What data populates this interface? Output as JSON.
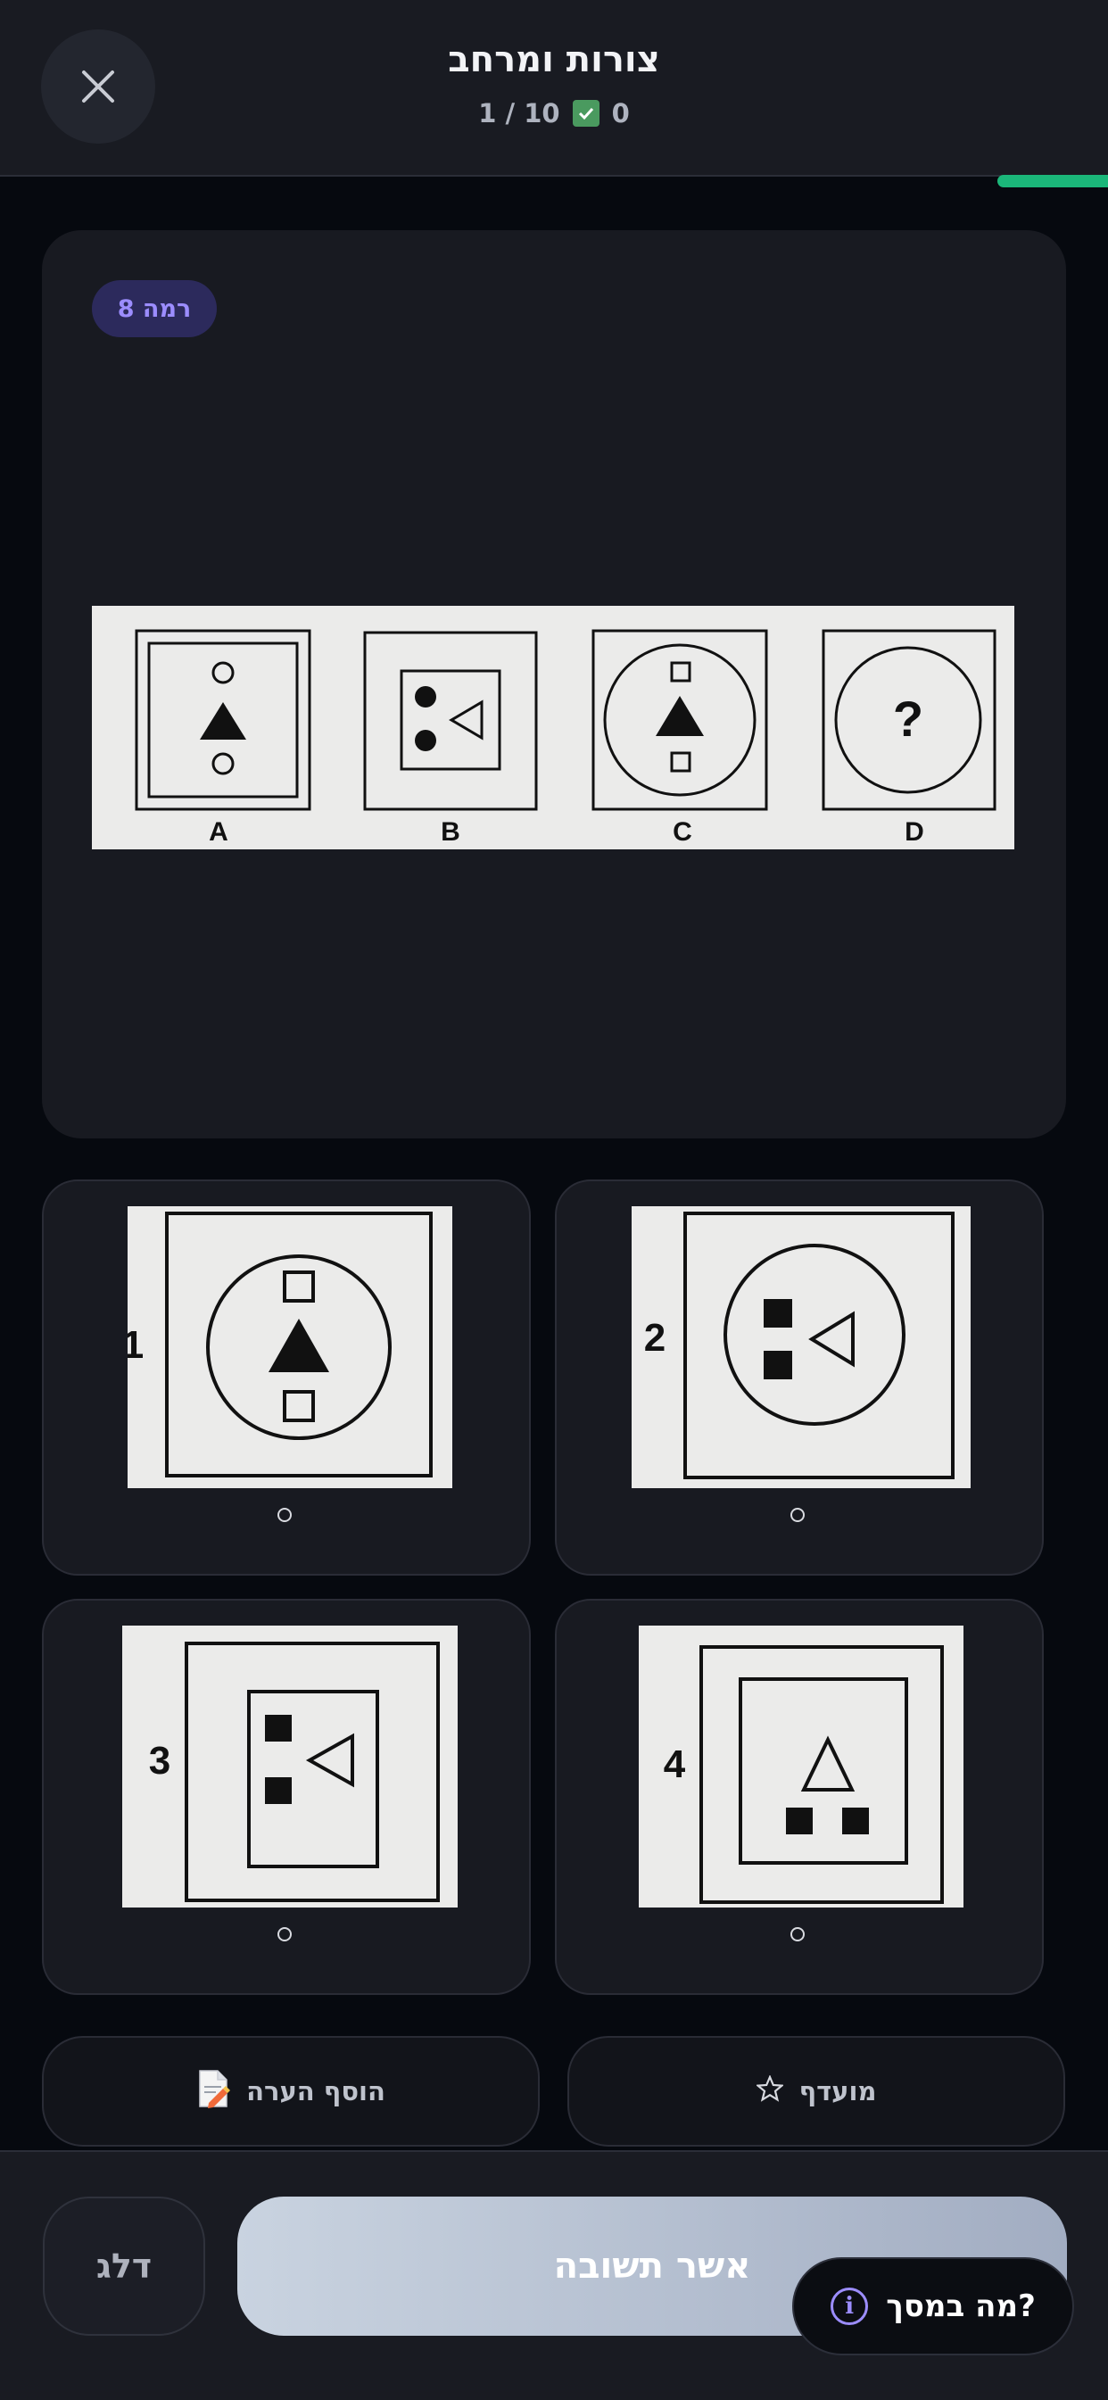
{
  "header": {
    "title": "צורות ומרחב",
    "progress_text": "1 / 10",
    "correct_count": "0",
    "progress_fraction": 0.1
  },
  "question": {
    "level_badge": "רמה 8",
    "labels": [
      "A",
      "B",
      "C",
      "D"
    ],
    "unknown_mark": "?"
  },
  "options": [
    {
      "number": "1"
    },
    {
      "number": "2"
    },
    {
      "number": "3"
    },
    {
      "number": "4"
    }
  ],
  "actions": {
    "favorite_label": "מועדף",
    "add_note_label": "הוסף הערה"
  },
  "footer": {
    "skip_label": "דלג",
    "confirm_label": "אשר תשובה",
    "help_label": "מה במסך?"
  },
  "colors": {
    "background": "#06090f",
    "card": "#181a21",
    "accent_green": "#1bb77a",
    "accent_purple": "#9c8dff"
  },
  "icons": [
    "close-icon",
    "check-icon",
    "star-icon",
    "note-icon",
    "info-icon"
  ]
}
